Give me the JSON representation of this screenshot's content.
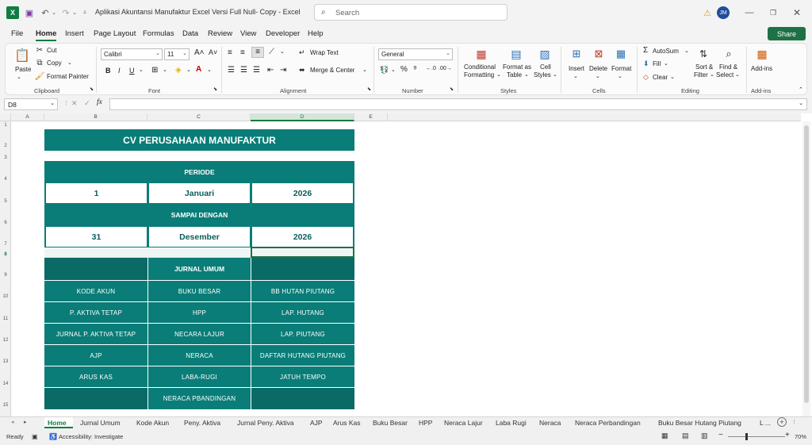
{
  "titlebar": {
    "doc_title": "Aplikasi Akuntansi Manufaktur Excel Versi Full Null- Copy  -  Excel",
    "search_placeholder": "Search",
    "avatar": "JM"
  },
  "menu": [
    "File",
    "Home",
    "Insert",
    "Page Layout",
    "Formulas",
    "Data",
    "Review",
    "View",
    "Developer",
    "Help"
  ],
  "share_label": "Share",
  "ribbon": {
    "clipboard": {
      "paste": "Paste",
      "cut": "Cut",
      "copy": "Copy",
      "format_painter": "Format Painter",
      "label": "Clipboard"
    },
    "font": {
      "name": "Calibri",
      "size": "11",
      "label": "Font"
    },
    "alignment": {
      "wrap": "Wrap Text",
      "merge": "Merge & Center",
      "label": "Alignment"
    },
    "number": {
      "format": "General",
      "label": "Number"
    },
    "styles": {
      "cond1": "Conditional",
      "cond2": "Formatting",
      "fmt1": "Format as",
      "fmt2": "Table",
      "cell1": "Cell",
      "cell2": "Styles",
      "label": "Styles"
    },
    "cells": {
      "insert": "Insert",
      "delete": "Delete",
      "format": "Format",
      "label": "Cells"
    },
    "editing": {
      "autosum": "AutoSum",
      "fill": "Fill",
      "clear": "Clear",
      "sort1": "Sort &",
      "sort2": "Filter",
      "find1": "Find &",
      "find2": "Select",
      "label": "Editing"
    },
    "addins": {
      "btn": "Add-ins",
      "label": "Add-ins"
    }
  },
  "formula_bar": {
    "namebox": "D8",
    "fx": "fx",
    "value": ""
  },
  "columns": [
    "A",
    "B",
    "C",
    "D",
    "E"
  ],
  "rows": [
    "1",
    "2",
    "3",
    "4",
    "5",
    "6",
    "7",
    "8",
    "9",
    "10",
    "11",
    "12",
    "13",
    "14",
    "15"
  ],
  "sheet": {
    "company": "CV PERUSAHAAN MANUFAKTUR",
    "periode_label": "PERIODE",
    "start": {
      "day": "1",
      "month": "Januari",
      "year": "2026"
    },
    "sampai_label": "SAMPAI DENGAN",
    "end": {
      "day": "31",
      "month": "Desember",
      "year": "2026"
    },
    "jurnal_umum": "JURNAL UMUM",
    "nav_buttons": [
      [
        "KODE AKUN",
        "BUKU BESAR",
        "BB HUTAN PIUTANG"
      ],
      [
        "P. AKTIVA TETAP",
        "HPP",
        "LAP. HUTANG"
      ],
      [
        "JURNAL P. AKTIVA TETAP",
        "NECARA LAJUR",
        "LAP. PIUTANG"
      ],
      [
        "AJP",
        "NERACA",
        "DAFTAR HUTANG PIUTANG"
      ],
      [
        "ARUS KAS",
        "LABA-RUGI",
        "JATUH TEMPO"
      ],
      [
        "",
        "NERACA PBANDINGAN",
        ""
      ]
    ]
  },
  "sheet_tabs": [
    "Home",
    "Jurnal Umum",
    "Kode Akun",
    "Peny. Aktiva",
    "Jurnal Peny. Aktiva",
    "AJP",
    "Arus Kas",
    "Buku Besar",
    "HPP",
    "Neraca Lajur",
    "Laba Rugi",
    "Neraca",
    "Neraca Perbandingan",
    "Buku Besar Hutang Piutang",
    "L ..."
  ],
  "status": {
    "ready": "Ready",
    "accessibility": "Accessibility: Investigate",
    "zoom": "70%"
  },
  "colors": {
    "teal": "#0a7d78",
    "teal_dark": "#0a6a65",
    "excel_green": "#107c41"
  }
}
